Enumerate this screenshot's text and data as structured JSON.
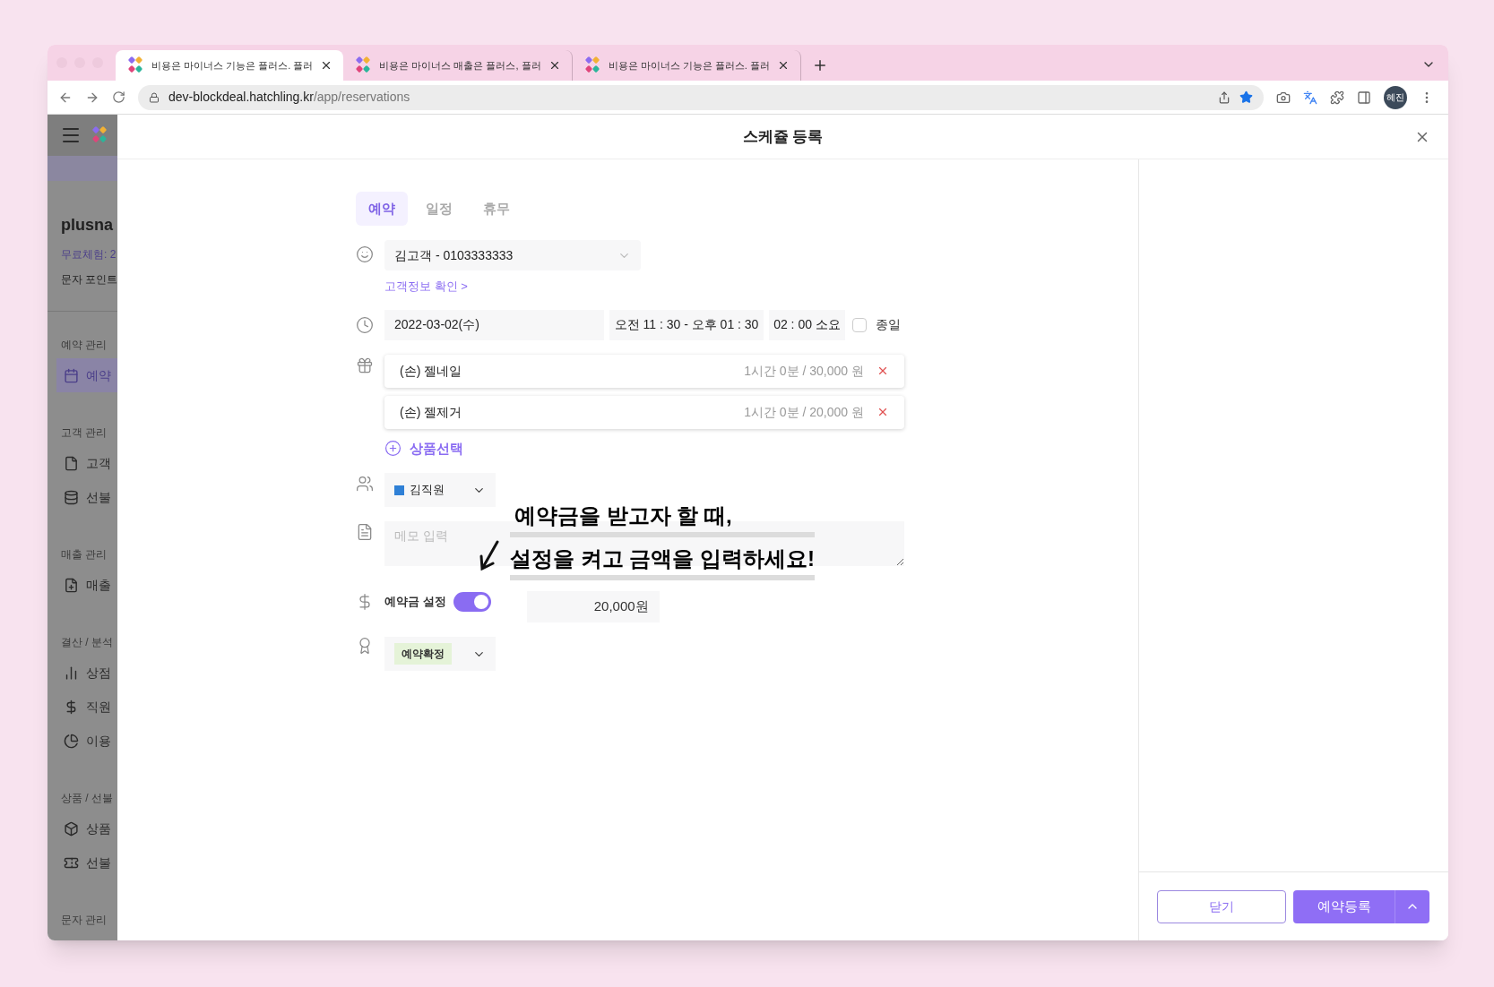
{
  "browser": {
    "tabs": [
      {
        "title": "비용은 마이너스 기능은 플러스. 플러",
        "selected": true
      },
      {
        "title": "비용은 마이너스 매출은 플러스, 플러",
        "selected": false
      },
      {
        "title": "비용은 마이너스 기능은 플러스. 플러",
        "selected": false
      }
    ],
    "url_host": "dev-blockdeal.hatchling.kr",
    "url_path": "/app/reservations",
    "profile": "혜진"
  },
  "sidebar": {
    "brand": "plusna",
    "trial": "무료체험: 2",
    "points": "문자 포인트",
    "sections": [
      {
        "title": "예약 관리",
        "items": [
          {
            "label": "예약",
            "kind": "calendar",
            "selected": true
          }
        ]
      },
      {
        "title": "고객 관리",
        "items": [
          {
            "label": "고객",
            "kind": "file",
            "selected": false
          },
          {
            "label": "선불",
            "kind": "database",
            "selected": false
          }
        ]
      },
      {
        "title": "매출 관리",
        "items": [
          {
            "label": "매출",
            "kind": "file-plus",
            "selected": false
          }
        ]
      },
      {
        "title": "결산 / 분석",
        "items": [
          {
            "label": "상점",
            "kind": "bars",
            "selected": false
          },
          {
            "label": "직원",
            "kind": "dollar",
            "selected": false
          },
          {
            "label": "이용",
            "kind": "pie",
            "selected": false
          }
        ]
      },
      {
        "title": "상품 / 선불",
        "items": [
          {
            "label": "상품",
            "kind": "box",
            "selected": false
          },
          {
            "label": "선불",
            "kind": "ticket",
            "selected": false
          }
        ]
      },
      {
        "title": "문자 관리"
      }
    ]
  },
  "modal": {
    "title": "스케쥴 등록",
    "tabs": [
      {
        "label": "예약",
        "selected": true
      },
      {
        "label": "일정",
        "selected": false
      },
      {
        "label": "휴무",
        "selected": false
      }
    ],
    "customer": "김고객 - 0103333333",
    "customer_link": "고객정보 확인 >",
    "date": "2022-03-02(수)",
    "time_range": "오전 11 : 30 - 오후 01 : 30",
    "duration": "02 : 00 소요",
    "all_day": {
      "label": "종일",
      "checked": false
    },
    "services": [
      {
        "name": "(손) 젤네일",
        "detail": "1시간 0분 / 30,000 원"
      },
      {
        "name": "(손) 젤제거",
        "detail": "1시간 0분 / 20,000 원"
      }
    ],
    "add_service": "상품선택",
    "staff": {
      "name": "김직원",
      "color": "#2f80d6"
    },
    "memo": {
      "placeholder": "메모 입력"
    },
    "deposit": {
      "label": "예약금 설정",
      "on": true,
      "amount": "20,000원"
    },
    "status": {
      "label": "예약확정"
    },
    "buttons": {
      "close": "닫기",
      "submit": "예약등록"
    }
  },
  "annotation": {
    "lines": [
      "예약금을 받고자 할 때,",
      "설정을 켜고 금액을 입력하세요!"
    ]
  }
}
